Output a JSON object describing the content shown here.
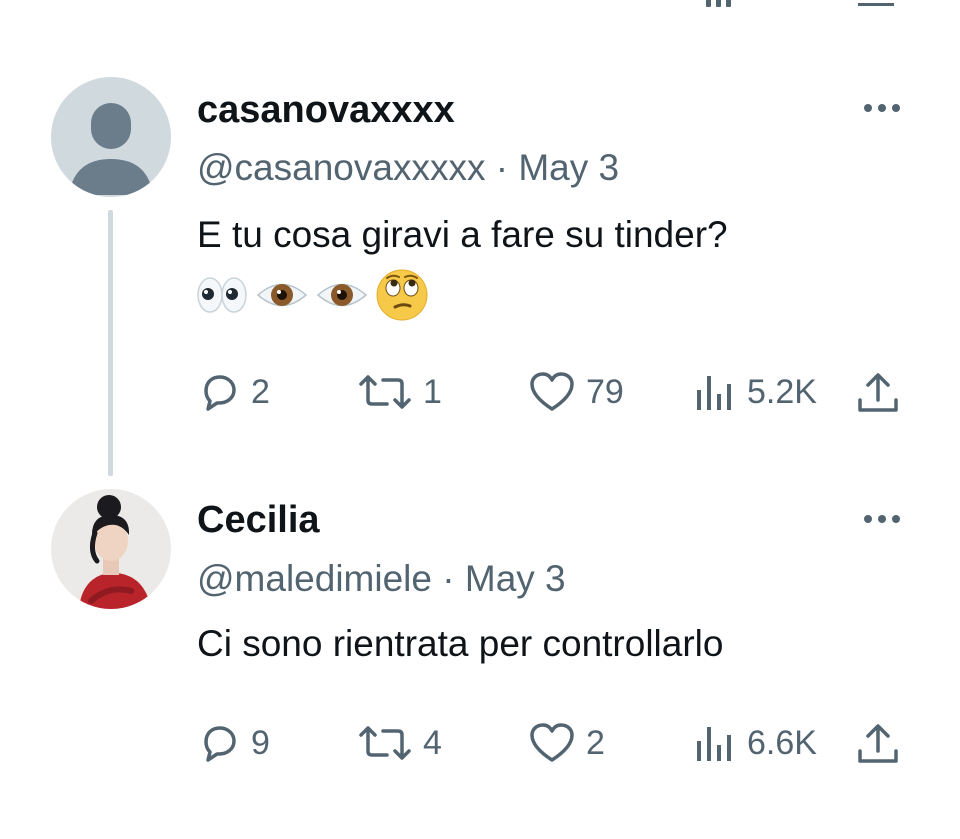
{
  "posts": [
    {
      "display_name": "casanovaxxxx",
      "handle": "@casanovaxxxxx",
      "date": "May 3",
      "text": "E tu cosa giravi a fare su tinder?",
      "emojis": [
        "eyes",
        "eye",
        "eye",
        "face-with-rolling-eyes"
      ],
      "replies": "2",
      "reposts": "1",
      "likes": "79",
      "views": "5.2K"
    },
    {
      "display_name": "Cecilia",
      "handle": "@maledimiele",
      "date": "May 3",
      "text": "Ci sono rientrata per controllarlo",
      "replies": "9",
      "reposts": "4",
      "likes": "2",
      "views": "6.6K"
    }
  ],
  "separator": "·",
  "icons": {
    "reply": "reply-icon",
    "repost": "repost-icon",
    "like": "heart-icon",
    "views": "views-icon",
    "share": "share-icon",
    "more": "more-icon"
  },
  "colors": {
    "text": "#0f1419",
    "secondary": "#536471",
    "thread_line": "#cfd9de",
    "default_avatar_bg": "#cfd9de",
    "default_avatar_fg": "#6b7c8b"
  }
}
